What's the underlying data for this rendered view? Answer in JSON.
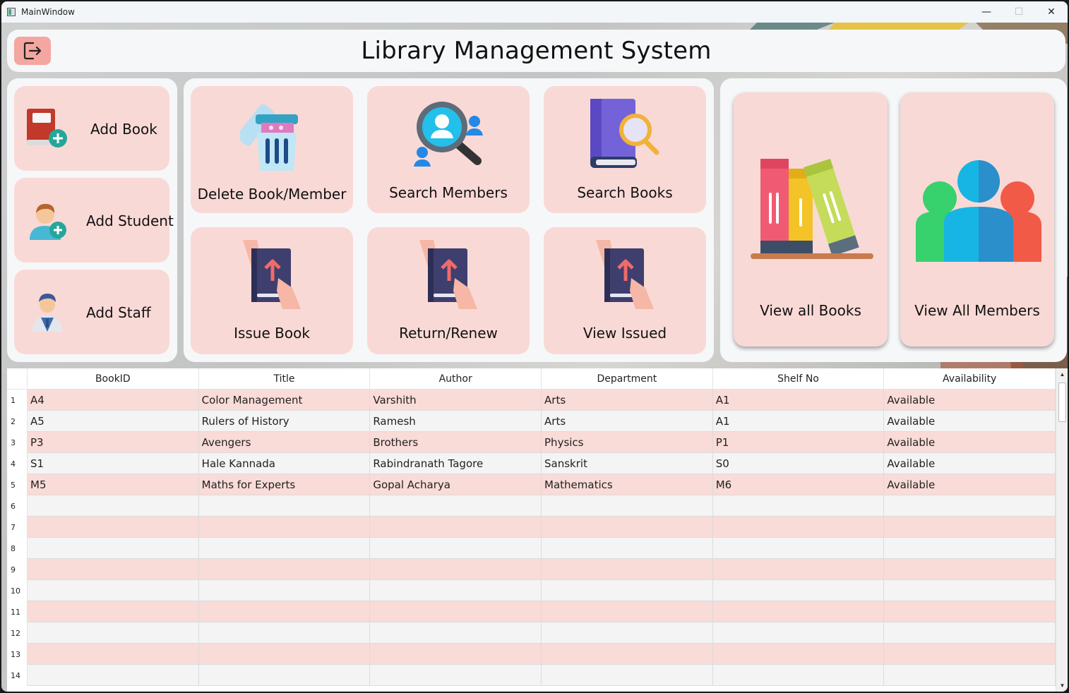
{
  "window": {
    "title": "MainWindow",
    "minimize": "—",
    "maximize": "☐",
    "close": "✕"
  },
  "header": {
    "title": "Library Management System",
    "logout_icon": "logout-icon"
  },
  "left_panel": {
    "items": [
      {
        "label": "Add Book",
        "icon": "add-book-icon"
      },
      {
        "label": "Add Student",
        "icon": "add-student-icon"
      },
      {
        "label": "Add Staff",
        "icon": "staff-icon"
      }
    ]
  },
  "mid_panel": {
    "items": [
      {
        "label": "Delete Book/Member",
        "icon": "trash-icon"
      },
      {
        "label": "Search Members",
        "icon": "search-members-icon"
      },
      {
        "label": "Search Books",
        "icon": "search-books-icon"
      },
      {
        "label": "Issue Book",
        "icon": "issue-book-icon"
      },
      {
        "label": "Return/Renew",
        "icon": "return-book-icon"
      },
      {
        "label": "View Issued",
        "icon": "view-issued-icon"
      }
    ]
  },
  "right_panel": {
    "items": [
      {
        "label": "View all Books",
        "icon": "books-shelf-icon"
      },
      {
        "label": "View All Members",
        "icon": "members-group-icon"
      }
    ]
  },
  "table": {
    "columns": [
      "BookID",
      "Title",
      "Author",
      "Department",
      "Shelf No",
      "Availability"
    ],
    "row_numbers": [
      "1",
      "2",
      "3",
      "4",
      "5",
      "6",
      "7",
      "8",
      "9",
      "10",
      "11",
      "12",
      "13",
      "14"
    ],
    "rows": [
      [
        "A4",
        "Color Management",
        "Varshith",
        "Arts",
        "A1",
        "Available"
      ],
      [
        "A5",
        "Rulers of History",
        "Ramesh",
        "Arts",
        "A1",
        "Available"
      ],
      [
        "P3",
        "Avengers",
        "Brothers",
        "Physics",
        "P1",
        "Available"
      ],
      [
        "S1",
        "Hale Kannada",
        "Rabindranath Tagore",
        "Sanskrit",
        "S0",
        "Available"
      ],
      [
        "M5",
        "Maths for Experts",
        "Gopal Acharya",
        "Mathematics",
        "M6",
        "Available"
      ],
      [
        "",
        "",
        "",
        "",
        "",
        ""
      ],
      [
        "",
        "",
        "",
        "",
        "",
        ""
      ],
      [
        "",
        "",
        "",
        "",
        "",
        ""
      ],
      [
        "",
        "",
        "",
        "",
        "",
        ""
      ],
      [
        "",
        "",
        "",
        "",
        "",
        ""
      ],
      [
        "",
        "",
        "",
        "",
        "",
        ""
      ],
      [
        "",
        "",
        "",
        "",
        "",
        ""
      ],
      [
        "",
        "",
        "",
        "",
        "",
        ""
      ],
      [
        "",
        "",
        "",
        "",
        "",
        ""
      ]
    ]
  },
  "colors": {
    "tile": "#f9d9d6",
    "panel": "#f6f7f8",
    "logout_button": "#f4a6a0",
    "row_odd": "#f9dbd8",
    "row_even": "#f4f4f4"
  }
}
